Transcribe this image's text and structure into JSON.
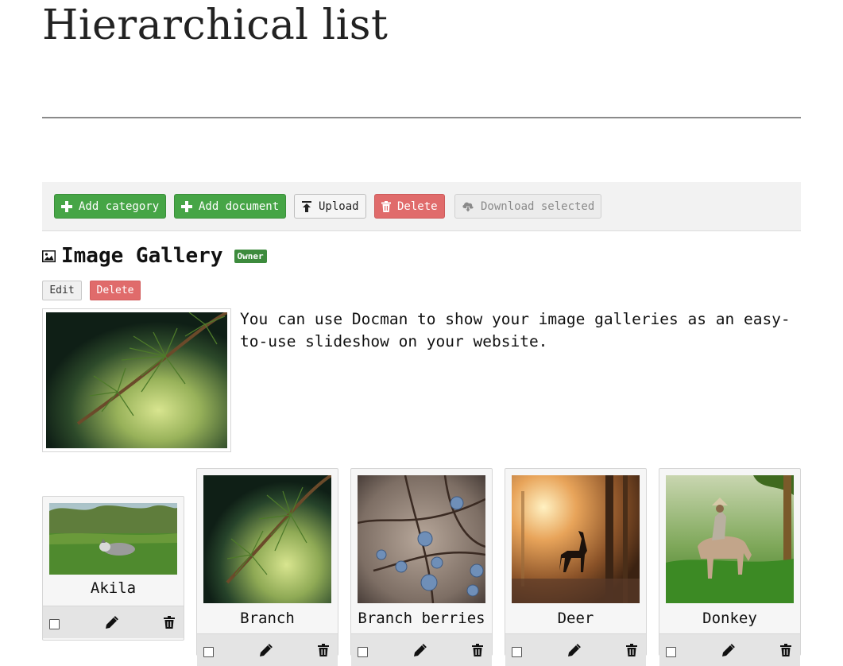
{
  "page": {
    "title": "Hierarchical list"
  },
  "toolbar": {
    "add_category": "Add category",
    "add_document": "Add document",
    "upload": "Upload",
    "delete": "Delete",
    "download_selected": "Download selected"
  },
  "category": {
    "icon": "image-icon",
    "title": "Image Gallery",
    "badge": "Owner",
    "edit_label": "Edit",
    "delete_label": "Delete",
    "description": "You can use Docman to show your image galleries as an easy-to-use slideshow on your website."
  },
  "documents": [
    {
      "name": "Akila",
      "selected": false
    },
    {
      "name": "Branch",
      "selected": false
    },
    {
      "name": "Branch berries",
      "selected": false
    },
    {
      "name": "Deer",
      "selected": false
    },
    {
      "name": "Donkey",
      "selected": false
    }
  ],
  "colors": {
    "success": "#46a546",
    "danger": "#e06b6b",
    "badge": "#3d8b3d"
  }
}
